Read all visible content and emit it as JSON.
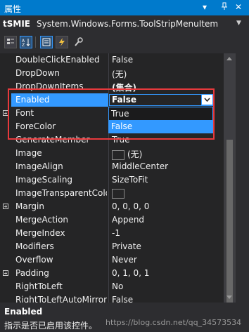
{
  "window": {
    "title": "属性",
    "dropdown_glyph": "▾",
    "pin_glyph": "ᚊ",
    "close_glyph": "✕"
  },
  "object_selector": {
    "name": "tSMIE",
    "type": "System.Windows.Forms.ToolStripMenuItem"
  },
  "toolbar": {
    "icons": [
      "categorized-icon",
      "alphabetical-icon",
      "properties-icon",
      "events-icon",
      "property-pages-icon"
    ]
  },
  "properties": [
    {
      "name": "DoubleClickEnabled",
      "value": "False"
    },
    {
      "name": "DropDown",
      "value": "(无)"
    },
    {
      "name": "DropDownItems",
      "value": "(集合)"
    },
    {
      "name": "Enabled",
      "value": "False",
      "selected": true
    },
    {
      "name": "Font",
      "value": "",
      "expandable": true
    },
    {
      "name": "ForeColor",
      "value": ""
    },
    {
      "name": "GenerateMember",
      "value": "True"
    },
    {
      "name": "Image",
      "value": "(无)",
      "swatch": true
    },
    {
      "name": "ImageAlign",
      "value": "MiddleCenter"
    },
    {
      "name": "ImageScaling",
      "value": "SizeToFit"
    },
    {
      "name": "ImageTransparentColor",
      "value": "",
      "swatch": true
    },
    {
      "name": "Margin",
      "value": "0, 0, 0, 0",
      "expandable": true
    },
    {
      "name": "MergeAction",
      "value": "Append"
    },
    {
      "name": "MergeIndex",
      "value": "-1"
    },
    {
      "name": "Modifiers",
      "value": "Private"
    },
    {
      "name": "Overflow",
      "value": "Never"
    },
    {
      "name": "Padding",
      "value": "0, 1, 0, 1",
      "expandable": true
    },
    {
      "name": "RightToLeft",
      "value": "No"
    },
    {
      "name": "RightToLeftAutoMirrorImage",
      "value": "False"
    }
  ],
  "dropdown_options": [
    {
      "label": "True",
      "highlighted": false
    },
    {
      "label": "False",
      "highlighted": true
    }
  ],
  "description": {
    "title": "Enabled",
    "text": "指示是否已启用该控件。"
  },
  "watermark": "https://blog.csdn.net/qq_34573534",
  "colors": {
    "accent": "#007acc",
    "selection": "#3399ff",
    "highlight_box": "#e8393c"
  }
}
